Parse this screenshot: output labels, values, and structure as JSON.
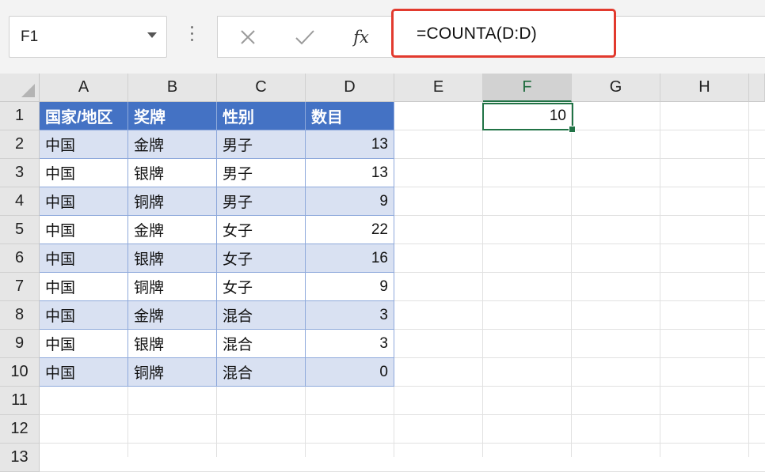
{
  "name_box": {
    "value": "F1"
  },
  "formula_bar": {
    "cancel_icon": "x-icon",
    "enter_icon": "check-icon",
    "fx_label": "fx",
    "formula": "=COUNTA(D:D)",
    "highlight_color": "#e23a2e"
  },
  "columns": [
    "A",
    "B",
    "C",
    "D",
    "E",
    "F",
    "G",
    "H"
  ],
  "rows": [
    "1",
    "2",
    "3",
    "4",
    "5",
    "6",
    "7",
    "8",
    "9",
    "10",
    "11",
    "12",
    "13"
  ],
  "table": {
    "header": [
      "国家/地区",
      "奖牌",
      "性别",
      "数目"
    ],
    "rows": [
      [
        "中国",
        "金牌",
        "男子",
        "13"
      ],
      [
        "中国",
        "银牌",
        "男子",
        "13"
      ],
      [
        "中国",
        "铜牌",
        "男子",
        "9"
      ],
      [
        "中国",
        "金牌",
        "女子",
        "22"
      ],
      [
        "中国",
        "银牌",
        "女子",
        "16"
      ],
      [
        "中国",
        "铜牌",
        "女子",
        "9"
      ],
      [
        "中国",
        "金牌",
        "混合",
        "3"
      ],
      [
        "中国",
        "银牌",
        "混合",
        "3"
      ],
      [
        "中国",
        "铜牌",
        "混合",
        "0"
      ]
    ],
    "header_color": "#4472c4",
    "band_color": "#d9e1f2"
  },
  "active_cell": {
    "ref": "F1",
    "value": "10"
  }
}
